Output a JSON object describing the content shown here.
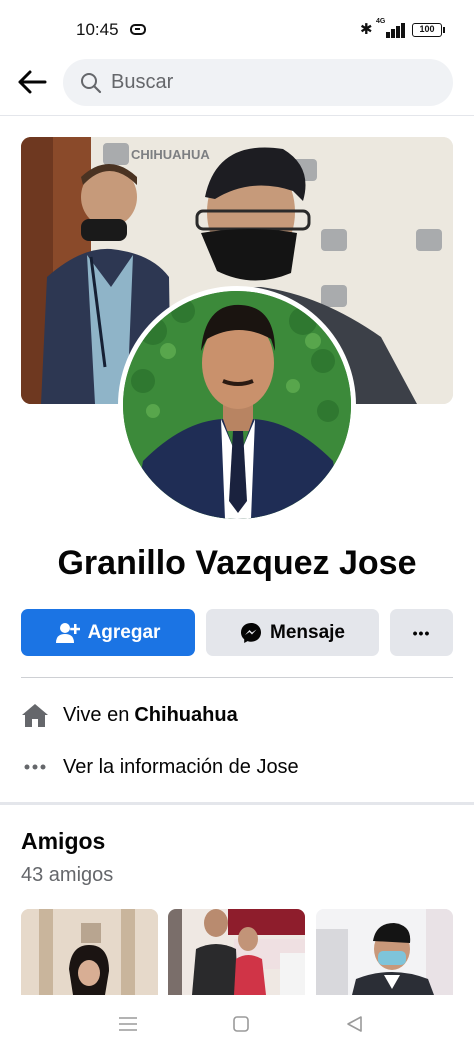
{
  "status_bar": {
    "time": "10:45",
    "battery": "100"
  },
  "search": {
    "placeholder": "Buscar"
  },
  "profile": {
    "name": "Granillo Vazquez Jose",
    "cover_banner_text": "CHIHUAHUA"
  },
  "actions": {
    "add_label": "Agregar",
    "message_label": "Mensaje",
    "more_label": "•••"
  },
  "info": {
    "lives_prefix": "Vive en",
    "lives_city": "Chihuahua",
    "about_label": "Ver la información de Jose"
  },
  "friends": {
    "title": "Amigos",
    "count_label": "43 amigos"
  },
  "colors": {
    "primary_button": "#1b74e4",
    "secondary_button": "#e4e6eb",
    "search_bg": "#f0f2f5",
    "muted_text": "#65676b"
  }
}
